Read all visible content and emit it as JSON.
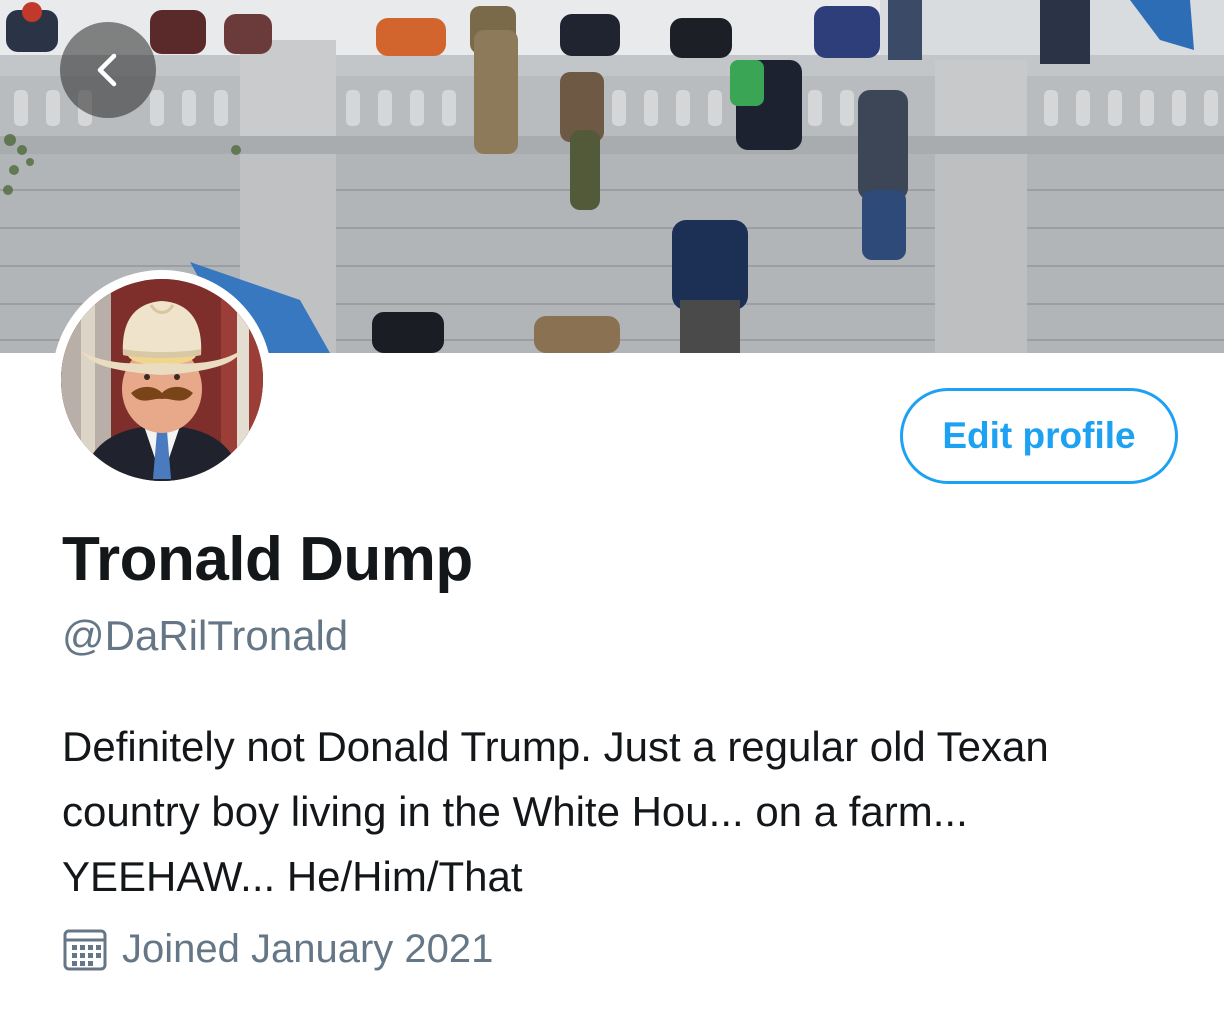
{
  "profile": {
    "display_name": "Tronald Dump",
    "handle": "@DaRilTronald",
    "bio": "Definitely not Donald Trump. Just a regular old Texan country boy living in the White Hou... on a farm... YEEHAW... He/Him/That",
    "joined": "Joined January 2021"
  },
  "actions": {
    "edit_profile_label": "Edit profile",
    "back_icon": "chevron-left-icon"
  },
  "icons": {
    "joined": "calendar-icon"
  },
  "colors": {
    "accent": "#1da1f2",
    "text_primary": "#14171a",
    "text_secondary": "#657786",
    "background": "#ffffff"
  }
}
